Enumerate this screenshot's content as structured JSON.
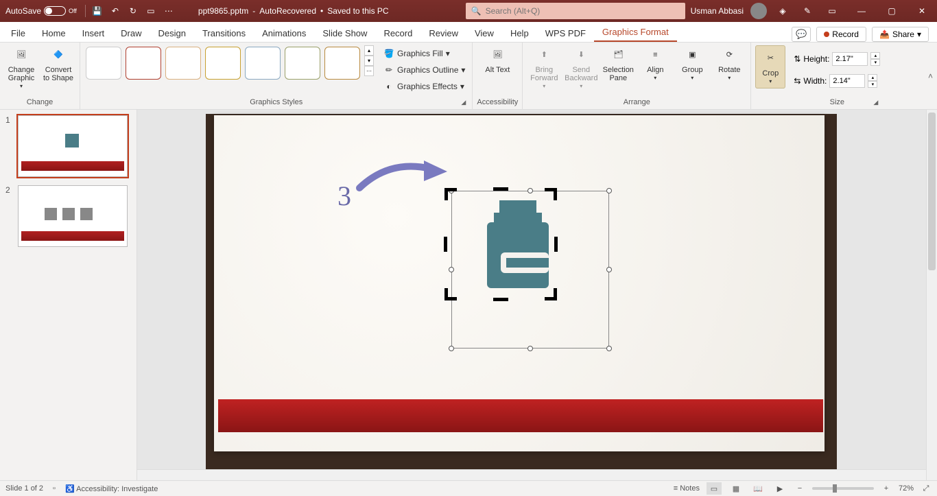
{
  "titlebar": {
    "autosave_label": "AutoSave",
    "autosave_state": "Off",
    "filename": "ppt9865.pptm",
    "status1": "AutoRecovered",
    "status2": "Saved to this PC",
    "search_placeholder": "Search (Alt+Q)",
    "user_name": "Usman Abbasi"
  },
  "tabs": {
    "file": "File",
    "home": "Home",
    "insert": "Insert",
    "draw": "Draw",
    "design": "Design",
    "transitions": "Transitions",
    "animations": "Animations",
    "slideshow": "Slide Show",
    "record": "Record",
    "review": "Review",
    "view": "View",
    "help": "Help",
    "wps": "WPS PDF",
    "graphics_format": "Graphics Format"
  },
  "ribbon_right": {
    "record": "Record",
    "share": "Share"
  },
  "ribbon": {
    "change": {
      "change_graphic": "Change Graphic",
      "convert_to_shape": "Convert to Shape",
      "group": "Change"
    },
    "styles": {
      "fill": "Graphics Fill",
      "outline": "Graphics Outline",
      "effects": "Graphics Effects",
      "group": "Graphics Styles"
    },
    "accessibility": {
      "alt_text": "Alt Text",
      "group": "Accessibility"
    },
    "arrange": {
      "bring_forward": "Bring Forward",
      "send_backward": "Send Backward",
      "selection_pane": "Selection Pane",
      "align": "Align",
      "group_btn": "Group",
      "rotate": "Rotate",
      "group": "Arrange"
    },
    "crop": "Crop",
    "size": {
      "height_label": "Height:",
      "height_value": "2.17\"",
      "width_label": "Width:",
      "width_value": "2.14\"",
      "group": "Size"
    }
  },
  "slides": {
    "s1": "1",
    "s2": "2"
  },
  "canvas": {
    "annotation_number": "3"
  },
  "status": {
    "slide": "Slide 1 of 2",
    "accessibility": "Accessibility: Investigate",
    "notes": "Notes",
    "zoom": "72%"
  }
}
